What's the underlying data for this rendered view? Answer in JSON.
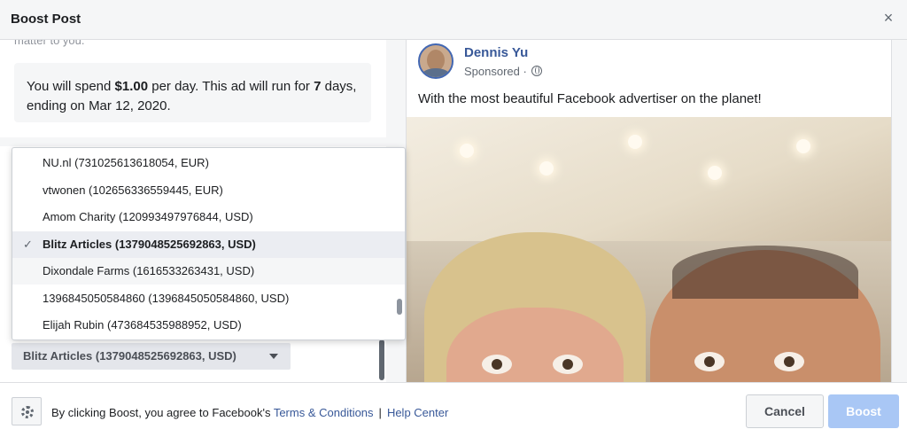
{
  "header": {
    "title": "Boost Post",
    "close_label": "×"
  },
  "left_panel": {
    "cut_text": "matter to you.",
    "spend": {
      "prefix": "You will spend ",
      "amount": "$1.00",
      "middle": " per day. This ad will run for ",
      "days": "7",
      "suffix": " days, ending on Mar 12, 2020."
    }
  },
  "dropdown": {
    "items": [
      {
        "label": "NU.nl (731025613618054, EUR)",
        "selected": false
      },
      {
        "label": "vtwonen (102656336559445, EUR)",
        "selected": false
      },
      {
        "label": "Amom Charity (120993497976844, USD)",
        "selected": false
      },
      {
        "label": "Blitz Articles (1379048525692863, USD)",
        "selected": true
      },
      {
        "label": "Dixondale Farms (1616533263431, USD)",
        "selected": false
      },
      {
        "label": "1396845050584860 (1396845050584860, USD)",
        "selected": false
      },
      {
        "label": "Elijah Rubin (473684535988952, USD)",
        "selected": false
      }
    ],
    "check_glyph": "✓",
    "selected_value": "Blitz Articles (1379048525692863, USD)"
  },
  "post": {
    "author": "Dennis Yu",
    "sponsored": "Sponsored ·",
    "caption": "With the most beautiful Facebook advertiser on the planet!"
  },
  "footer": {
    "agree_prefix": "By clicking Boost, you agree to Facebook's ",
    "terms_link": "Terms & Conditions",
    "separator": "|",
    "help_link": "Help Center",
    "cancel_label": "Cancel",
    "boost_label": "Boost"
  },
  "colors": {
    "accent": "#385898",
    "boost_disabled": "#a9c7f5",
    "panel_bg": "#f5f6f7"
  }
}
